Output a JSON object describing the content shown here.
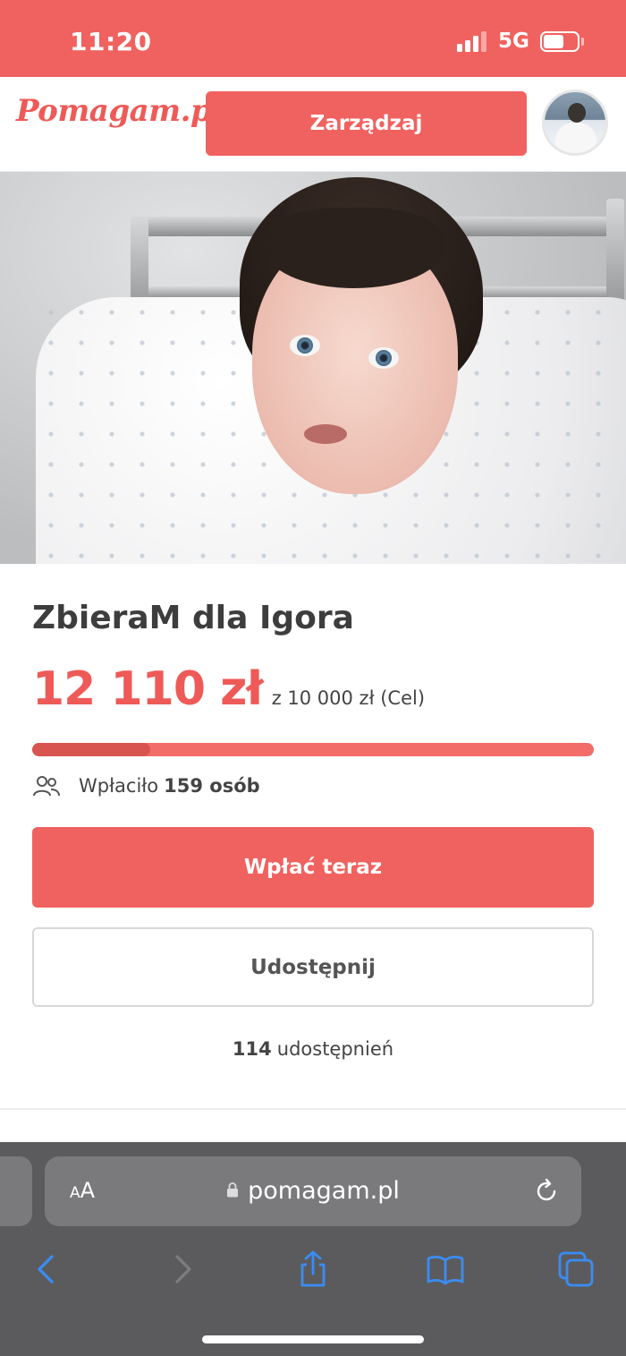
{
  "status_bar": {
    "time": "11:20",
    "network": "5G",
    "signal_bars": 3,
    "battery_level": 0.6
  },
  "header": {
    "logo": "Pomagam.pl",
    "manage_button": "Zarządzaj",
    "avatar": "user-avatar"
  },
  "campaign": {
    "title": "ZbieraM dla Igora",
    "raised": "12 110 zł",
    "goal": "z 10 000 zł (Cel)",
    "progress_fraction": 0.21,
    "donors_label": "Wpłaciło",
    "donors_count": "159 osób",
    "pay_button": "Wpłać teraz",
    "share_button": "Udostępnij",
    "shares_count": "114",
    "shares_label": "udostępnień"
  },
  "browser": {
    "text_size_big": "A",
    "text_size_small": "A",
    "url": "pomagam.pl",
    "icons": {
      "lock": "lock-icon",
      "reload": "reload-icon",
      "back": "chevron-left-icon",
      "forward": "chevron-right-icon",
      "share": "share-icon",
      "bookmarks": "book-icon",
      "tabs": "tabs-icon"
    }
  },
  "colors": {
    "brand": "#f0625f",
    "progress_track": "#f26c68",
    "progress_fill": "#d85450",
    "browser_bg": "#5b5b5e",
    "browser_accent": "#3a8df5"
  }
}
